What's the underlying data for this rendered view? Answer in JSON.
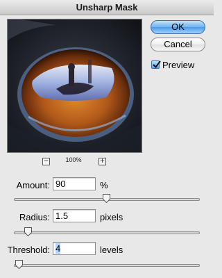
{
  "window": {
    "title": "Unsharp Mask"
  },
  "preview": {
    "zoom_minus": "−",
    "zoom_level": "100%",
    "zoom_plus": "+"
  },
  "buttons": {
    "ok": "OK",
    "cancel": "Cancel"
  },
  "preview_toggle": {
    "label": "Preview",
    "checked": true
  },
  "controls": {
    "amount": {
      "label": "Amount:",
      "value": "90",
      "unit": "%",
      "slider_fraction": 0.49
    },
    "radius": {
      "label": "Radius:",
      "value": "1.5",
      "unit": "pixels",
      "slider_fraction": 0.07
    },
    "threshold": {
      "label": "Threshold:",
      "value": "4",
      "unit": "levels",
      "slider_fraction": 0.02
    }
  },
  "colors": {
    "accent": "#4a9ae6",
    "window_bg": "#e8e8e8",
    "field_selection": "#b5d5ff"
  }
}
